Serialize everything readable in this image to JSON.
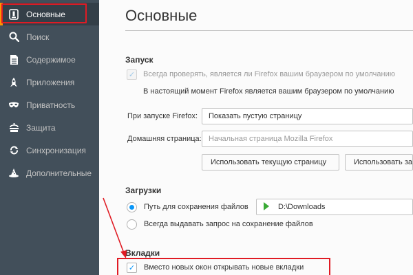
{
  "sidebar": {
    "items": [
      {
        "label": "Основные",
        "icon": "general-icon"
      },
      {
        "label": "Поиск",
        "icon": "search-icon"
      },
      {
        "label": "Содержимое",
        "icon": "content-icon"
      },
      {
        "label": "Приложения",
        "icon": "applications-icon"
      },
      {
        "label": "Приватность",
        "icon": "privacy-mask-icon"
      },
      {
        "label": "Защита",
        "icon": "security-icon"
      },
      {
        "label": "Синхронизация",
        "icon": "sync-icon"
      },
      {
        "label": "Дополнительные",
        "icon": "advanced-hat-icon"
      }
    ],
    "active_index": 0
  },
  "main": {
    "title": "Основные",
    "startup": {
      "heading": "Запуск",
      "default_check_label": "Всегда проверять, является ли Firefox вашим браузером по умолчанию",
      "default_status": "В настоящий момент Firefox является вашим браузером по умолчанию",
      "on_start_label": "При запуске Firefox:",
      "on_start_value": "Показать пустую страницу",
      "homepage_label": "Домашняя страница:",
      "homepage_placeholder": "Начальная страница Mozilla Firefox",
      "use_current_button": "Использовать текущую страницу",
      "use_bookmark_button": "Использовать закладку…"
    },
    "downloads": {
      "heading": "Загрузки",
      "save_path_label": "Путь для сохранения файлов",
      "save_path_value": "D:\\Downloads",
      "always_ask_label": "Всегда выдавать запрос на сохранение файлов"
    },
    "tabs": {
      "heading": "Вкладки",
      "open_new_tabs_label": "Вместо новых окон открывать новые вкладки",
      "open_new_tabs_checked": true
    }
  },
  "colors": {
    "sidebar_bg": "#424f5a",
    "sidebar_active_bg": "#343f48",
    "accent_blue": "#0996f8",
    "highlight_red": "#e01b24",
    "download_arrow_green": "#3aaa35"
  }
}
